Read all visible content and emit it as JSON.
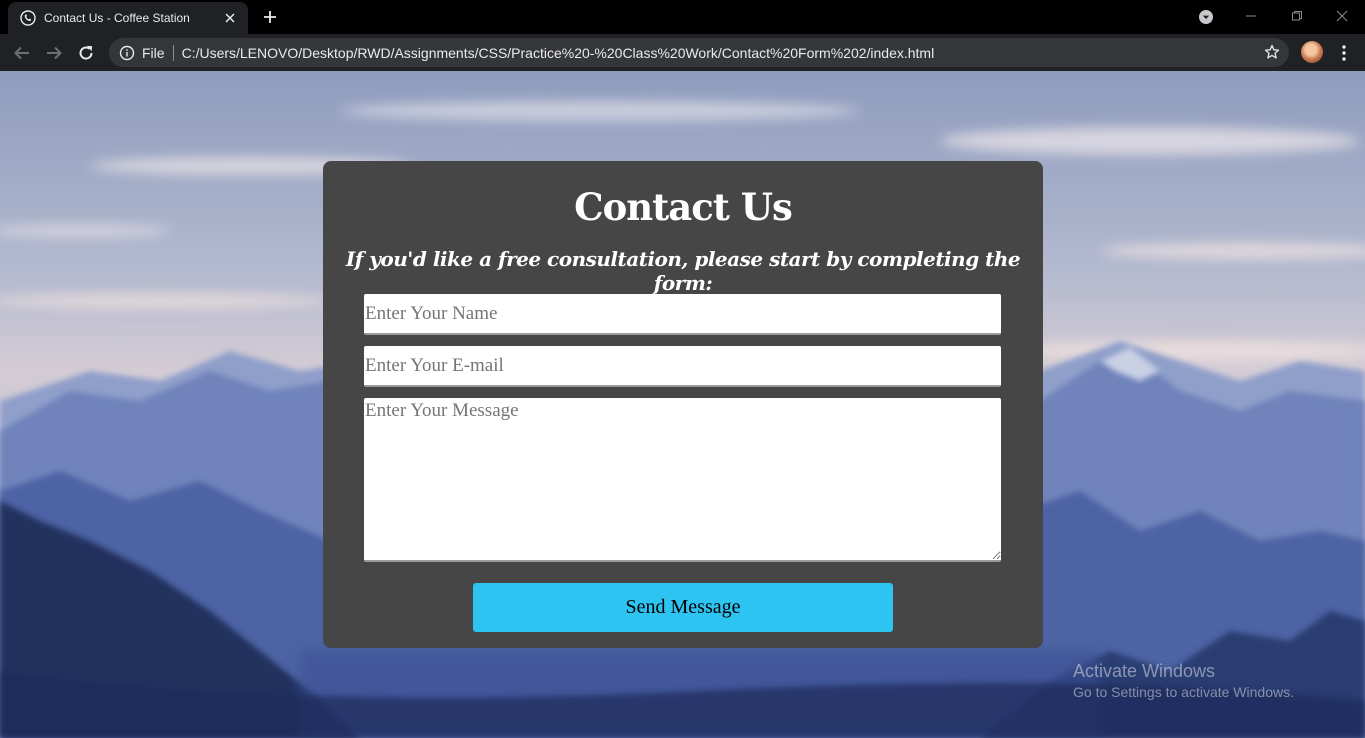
{
  "browser": {
    "tab_title": "Contact Us - Coffee Station",
    "url_scheme": "File",
    "url": "C:/Users/LENOVO/Desktop/RWD/Assignments/CSS/Practice%20-%20Class%20Work/Contact%20Form%202/index.html",
    "icons": [
      "phone-favicon-icon",
      "close-icon",
      "plus-icon",
      "back-icon",
      "forward-icon",
      "reload-icon",
      "info-icon",
      "star-icon",
      "kebab-menu-icon",
      "minimize-icon",
      "restore-icon",
      "window-close-icon",
      "chevron-down-icon"
    ]
  },
  "form": {
    "title": "Contact Us",
    "subtitle": "If you'd like a free consultation, please start by completing the form:",
    "name_placeholder": "Enter Your Name",
    "email_placeholder": "Enter Your E-mail",
    "message_placeholder": "Enter Your Message",
    "send_label": "Send Message"
  },
  "watermark": {
    "title": "Activate Windows",
    "subtitle": "Go to Settings to activate Windows."
  },
  "colors": {
    "card_bg": "#464646",
    "button_bg": "#2ec4f1",
    "chrome_dark": "#202124"
  }
}
